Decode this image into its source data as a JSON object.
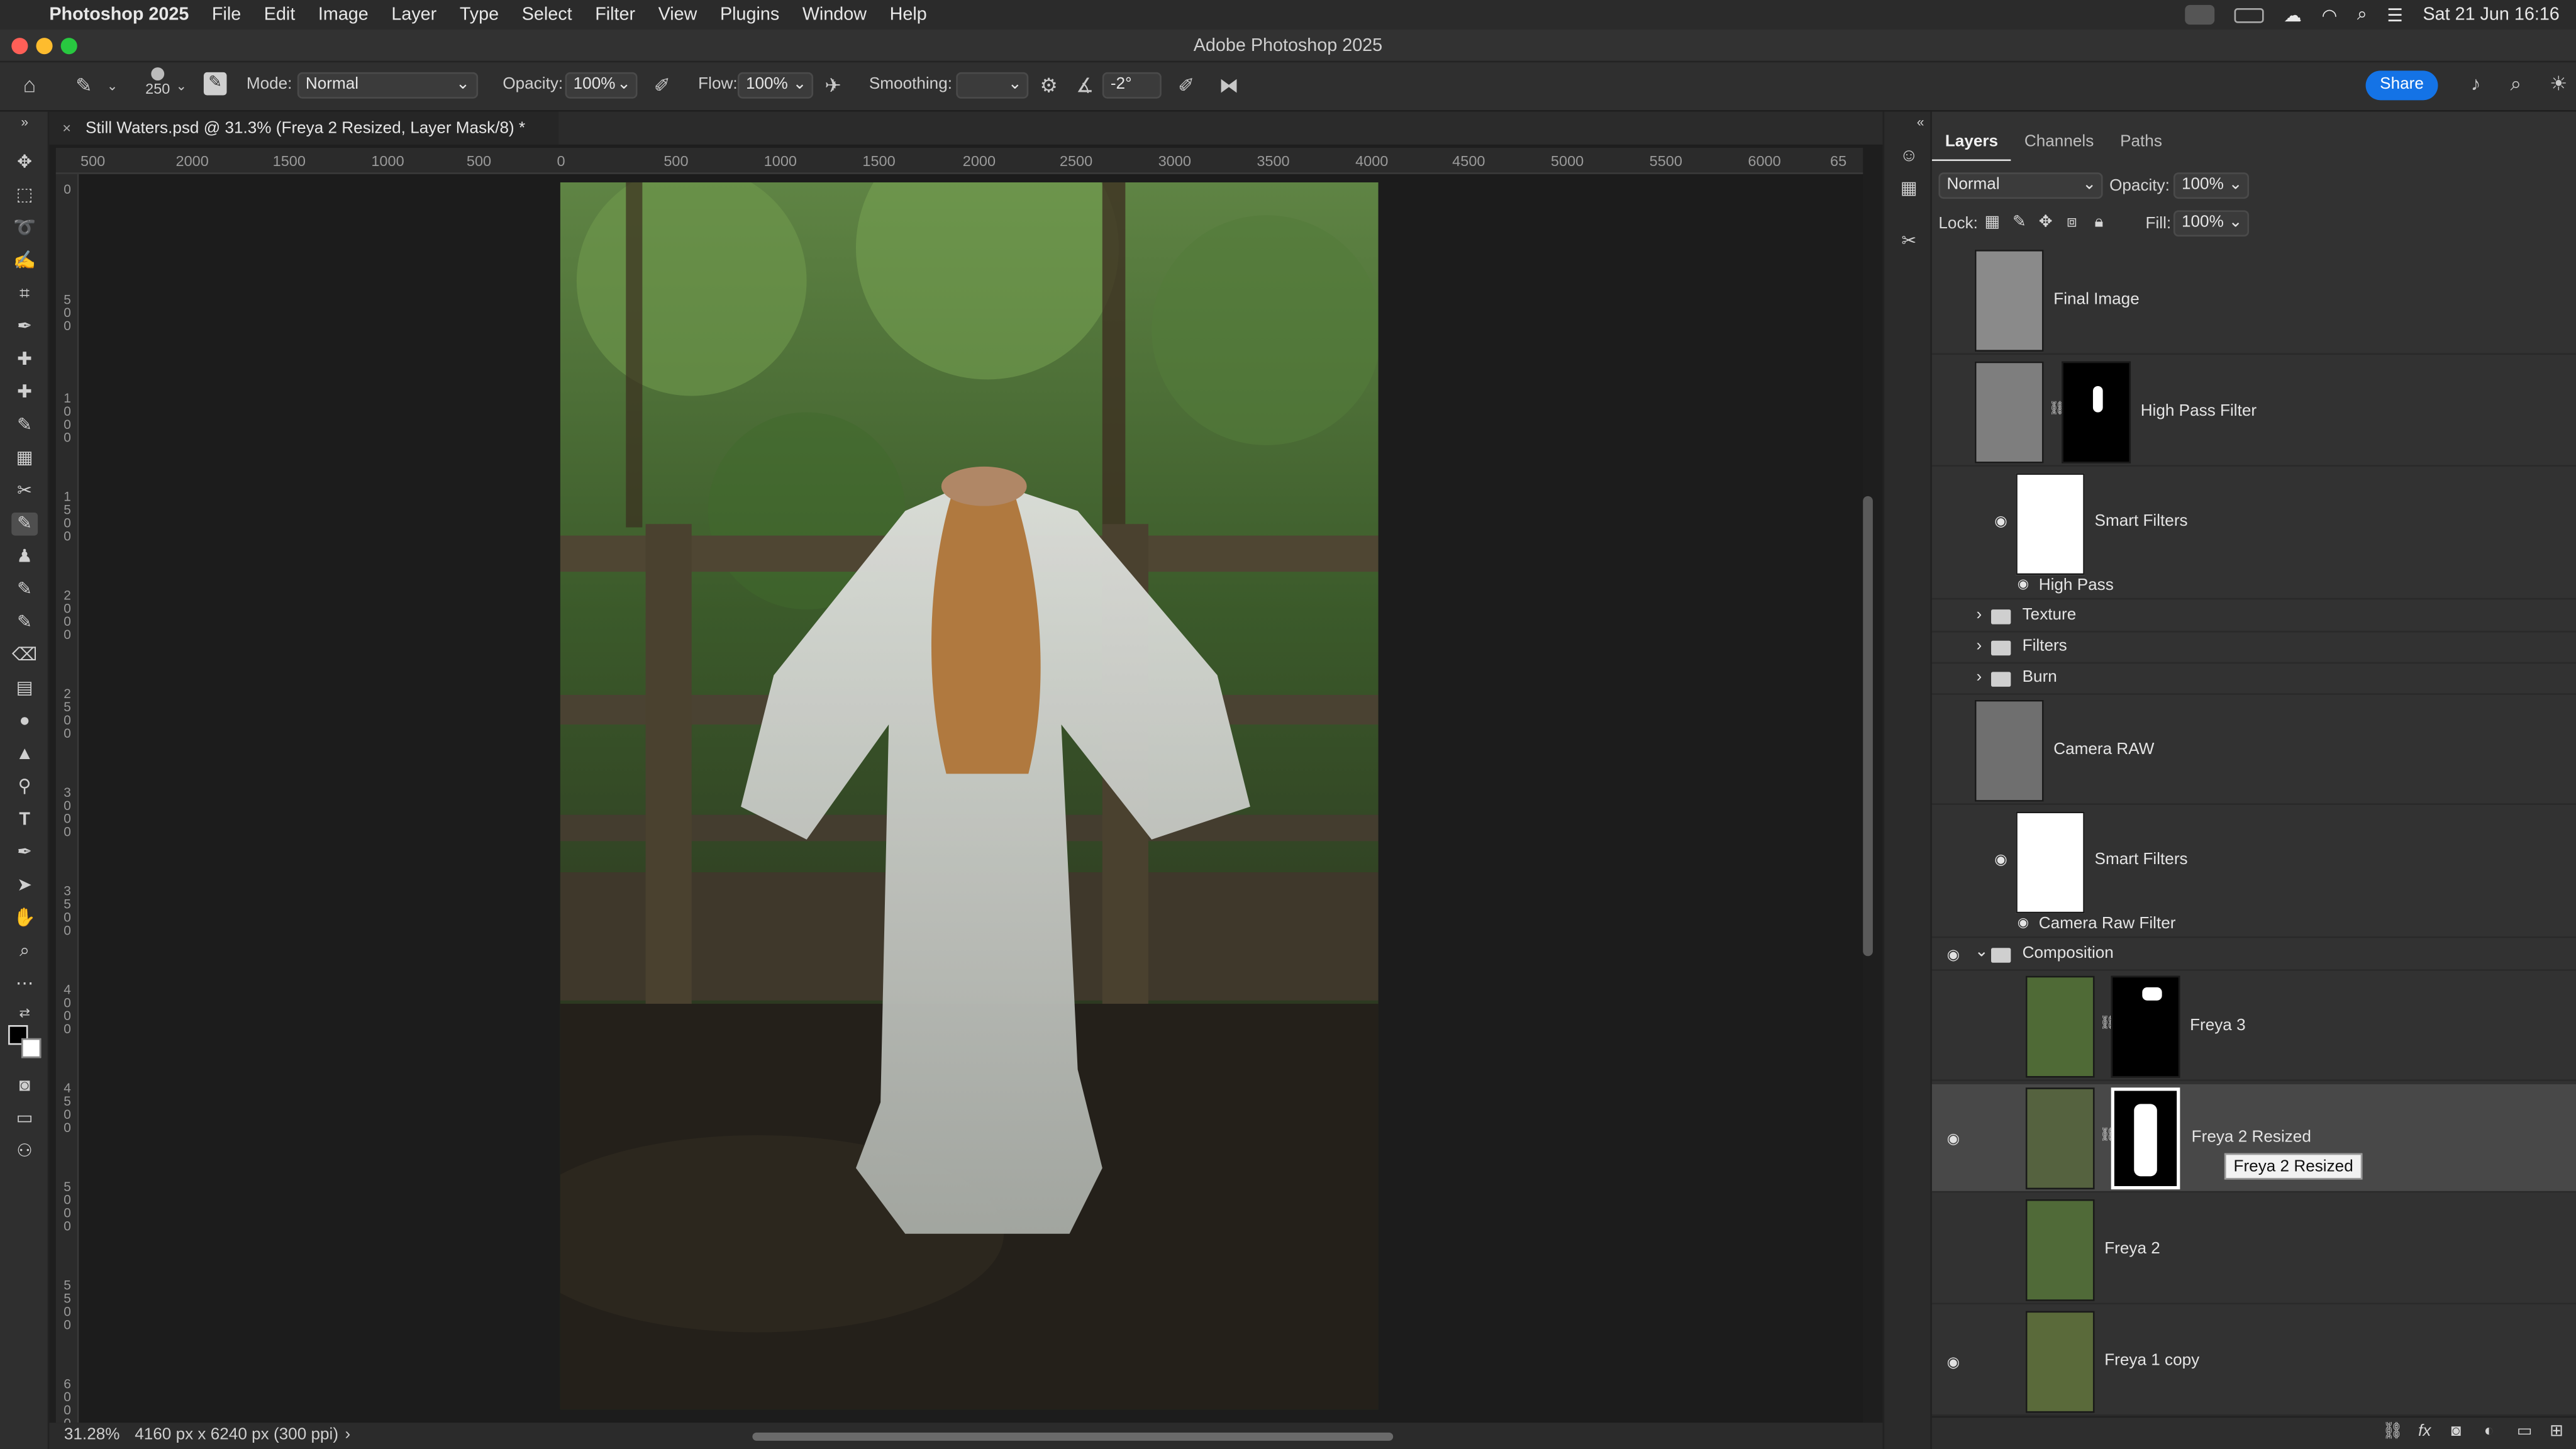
{
  "menubar": {
    "app": "Photoshop 2025",
    "items": [
      "File",
      "Edit",
      "Image",
      "Layer",
      "Type",
      "Select",
      "Filter",
      "View",
      "Plugins",
      "Window",
      "Help"
    ],
    "datetime": "Sat 21 Jun  16:16"
  },
  "window": {
    "title": "Adobe Photoshop 2025"
  },
  "options": {
    "brush_size": "250",
    "mode_label": "Mode:",
    "mode_value": "Normal",
    "opacity_label": "Opacity:",
    "opacity_value": "100%",
    "flow_label": "Flow:",
    "flow_value": "100%",
    "smoothing_label": "Smoothing:",
    "smoothing_value": "",
    "angle_value": "-2°",
    "share_label": "Share"
  },
  "document": {
    "tab_title": "Still Waters.psd @ 31.3% (Freya 2 Resized, Layer Mask/8) *"
  },
  "ruler": {
    "h_ticks": [
      "500",
      "2000",
      "1500",
      "1000",
      "500",
      "0",
      "500",
      "1000",
      "1500",
      "2000",
      "2500",
      "3000",
      "3500",
      "4000",
      "4500",
      "5000",
      "5500",
      "6000",
      "65"
    ],
    "v_ticks": [
      "0",
      "500",
      "1000",
      "1500",
      "2000",
      "2500",
      "3000",
      "3500",
      "4000",
      "4500",
      "5000",
      "5500",
      "6000"
    ]
  },
  "status": {
    "zoom": "31.28%",
    "doc_info": "4160 px x 6240 px (300 ppi)",
    "arrow": "›"
  },
  "panel": {
    "tabs": [
      "Layers",
      "Channels",
      "Paths"
    ],
    "blend_mode": "Normal",
    "opacity_label": "Opacity:",
    "opacity_value": "100%",
    "lock_label": "Lock:",
    "fill_label": "Fill:",
    "fill_value": "100%"
  },
  "layers": [
    {
      "name": "Final Image",
      "visible": false
    },
    {
      "name": "High Pass Filter",
      "visible": false
    },
    {
      "name": "Smart Filters",
      "visible": false
    },
    {
      "name": "High Pass",
      "visible": false
    },
    {
      "name": "Texture",
      "visible": false
    },
    {
      "name": "Filters",
      "visible": false
    },
    {
      "name": "Burn",
      "visible": false
    },
    {
      "name": "Camera RAW",
      "visible": false
    },
    {
      "name": "Smart Filters",
      "visible": false
    },
    {
      "name": "Camera Raw Filter",
      "visible": false
    },
    {
      "name": "Composition",
      "visible": true
    },
    {
      "name": "Freya 3",
      "visible": false
    },
    {
      "name": "Freya 2 Resized",
      "visible": true,
      "selected": true
    },
    {
      "name": "Freya 2",
      "visible": false
    },
    {
      "name": "Freya 1 copy",
      "visible": true
    }
  ],
  "tooltip": "Freya 2 Resized",
  "colors": {
    "accent": "#1473e6",
    "selected_row": "#484848",
    "panel_bg": "#323232"
  }
}
